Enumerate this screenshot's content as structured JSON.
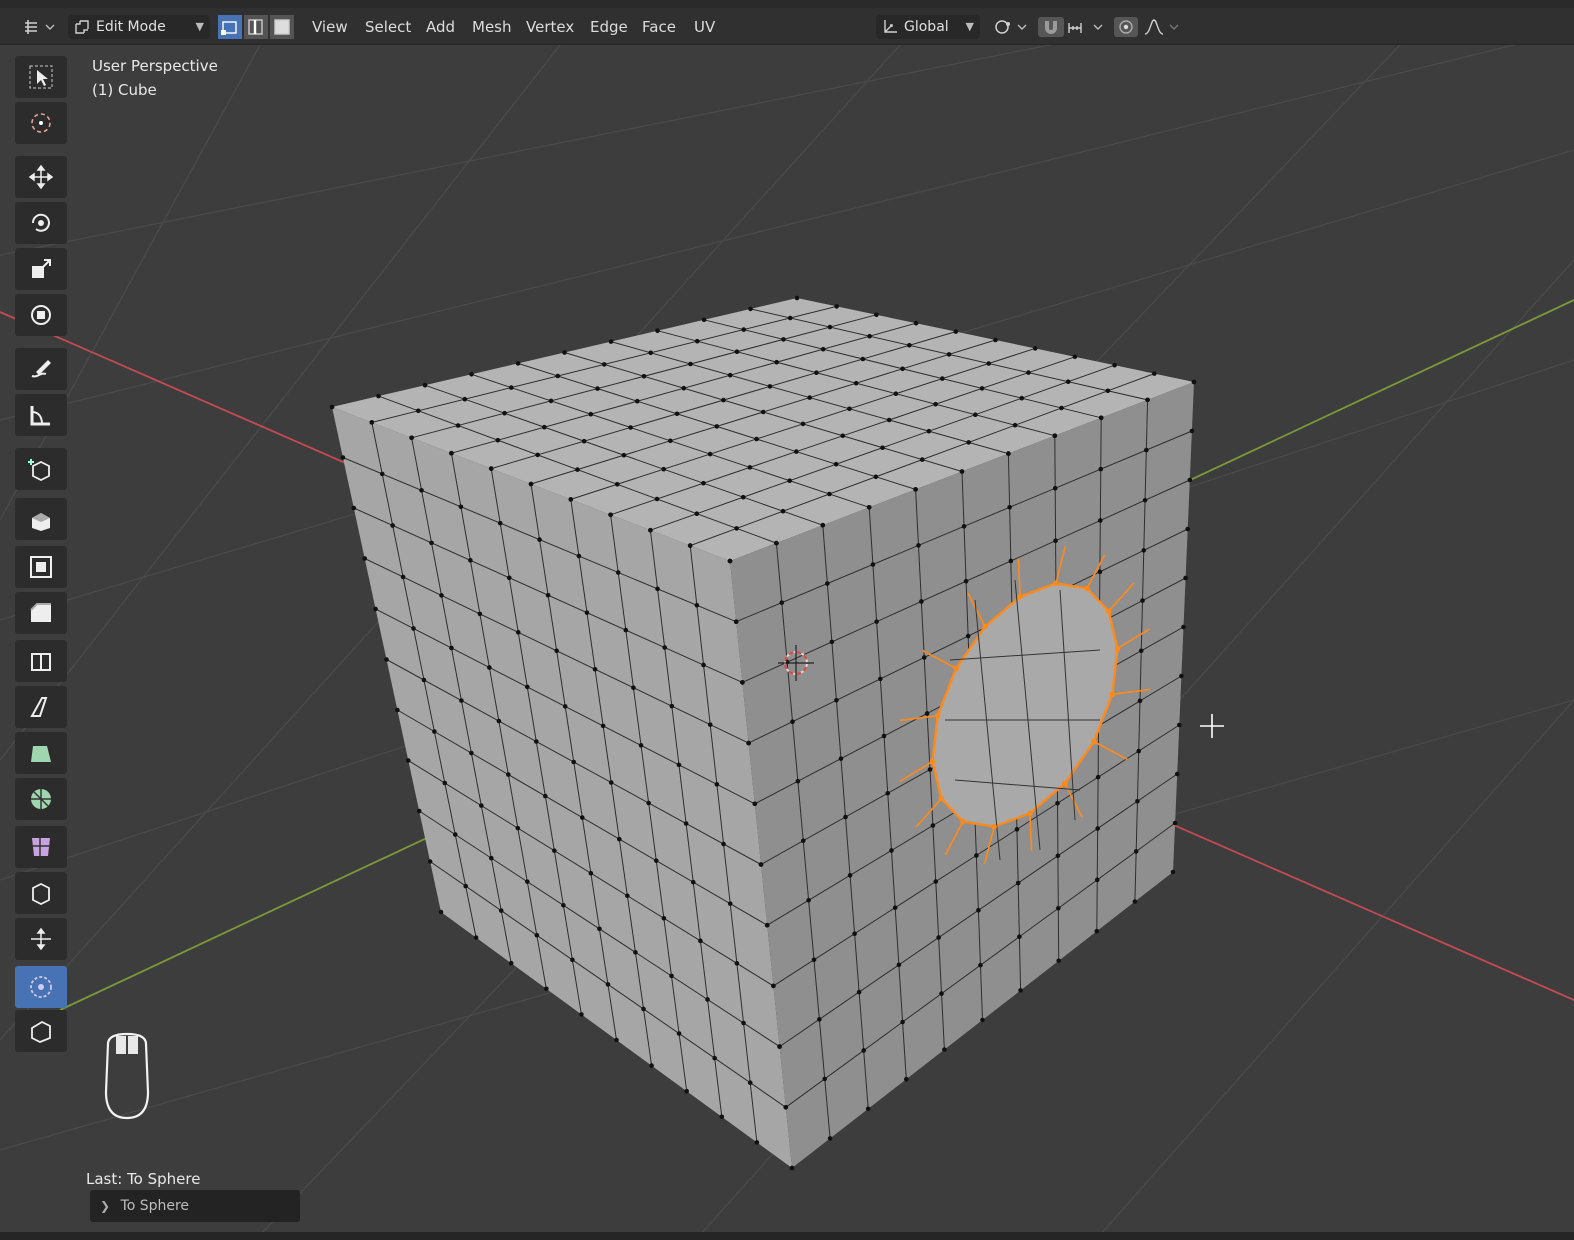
{
  "header": {
    "mode": {
      "label": "Edit Mode"
    },
    "menus": [
      "View",
      "Select",
      "Add",
      "Mesh",
      "Vertex",
      "Edge",
      "Face",
      "UV"
    ],
    "orientation": {
      "label": "Global"
    }
  },
  "viewport": {
    "perspective_label": "User Perspective",
    "object_label": "(1) Cube",
    "colors": {
      "background": "#3d3d3d",
      "grid": "#4a4a4a",
      "x_axis": "#c24a55",
      "y_axis": "#7a9a3a",
      "face": "#a6a6a6",
      "face_light": "#b4b4b4",
      "face_shade": "#8f8f8f",
      "selection": "#ff8a1a",
      "accent": "#4772b3"
    }
  },
  "toolbar": {
    "tools": [
      {
        "name": "select-box-tool",
        "icon": "cursor-box-icon"
      },
      {
        "name": "cursor-tool",
        "icon": "cursor-3d-icon"
      },
      {
        "name": "move-tool",
        "icon": "move-arrows-icon"
      },
      {
        "name": "rotate-tool",
        "icon": "rotate-icon"
      },
      {
        "name": "scale-tool",
        "icon": "scale-icon"
      },
      {
        "name": "transform-tool",
        "icon": "transform-icon"
      },
      {
        "name": "annotate-tool",
        "icon": "pencil-icon"
      },
      {
        "name": "measure-tool",
        "icon": "ruler-icon"
      },
      {
        "name": "add-cube-tool",
        "icon": "add-cube-icon"
      },
      {
        "name": "extrude-tool",
        "icon": "extrude-icon"
      },
      {
        "name": "inset-tool",
        "icon": "inset-icon"
      },
      {
        "name": "bevel-tool",
        "icon": "bevel-icon"
      },
      {
        "name": "loop-cut-tool",
        "icon": "loop-cut-icon"
      },
      {
        "name": "knife-tool",
        "icon": "knife-icon"
      },
      {
        "name": "poly-build-tool",
        "icon": "poly-build-icon"
      },
      {
        "name": "spin-tool",
        "icon": "spin-icon"
      },
      {
        "name": "smooth-tool",
        "icon": "smooth-icon"
      },
      {
        "name": "edge-slide-tool",
        "icon": "edge-slide-icon"
      },
      {
        "name": "shrink-fatten-tool",
        "icon": "shrink-icon"
      },
      {
        "name": "to-sphere-tool",
        "icon": "to-sphere-icon",
        "active": true
      },
      {
        "name": "rip-tool",
        "icon": "rip-icon"
      }
    ]
  },
  "last_operator": {
    "title": "Last: To Sphere",
    "panel_label": "To Sphere"
  }
}
